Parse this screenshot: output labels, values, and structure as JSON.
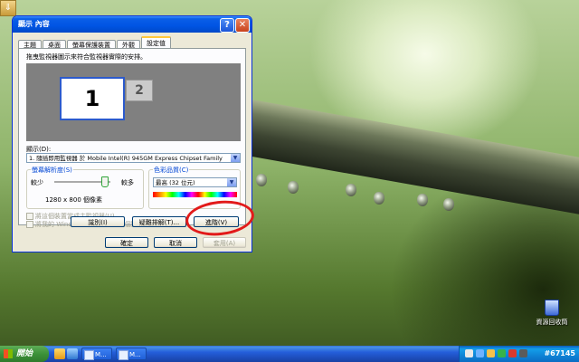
{
  "dialog": {
    "title": "顯示 內容",
    "help_label": "?",
    "close_label": "✕",
    "tabs": [
      {
        "label": "主題",
        "active": false
      },
      {
        "label": "桌面",
        "active": false
      },
      {
        "label": "螢幕保護裝置",
        "active": false
      },
      {
        "label": "外觀",
        "active": false
      },
      {
        "label": "設定值",
        "active": true
      }
    ],
    "instruction": "拖曳監視器圖示來符合監視器實際的安排。",
    "monitors": [
      "1",
      "2"
    ],
    "display_label": "顯示(D):",
    "display_value": "1. 隨插即用監視器 於 Mobile Intel(R) 945GM Express Chipset Family",
    "resolution": {
      "legend": "螢幕解析度(S)",
      "less": "較少",
      "more": "較多",
      "value_text": "1280 x 800 個像素",
      "slider_level": 0.9
    },
    "color_quality": {
      "legend": "色彩品質(C)",
      "value": "最高 (32 位元)"
    },
    "checkboxes": [
      {
        "label": "將這個裝置當成主監視器(U)",
        "checked": false,
        "enabled": false
      },
      {
        "label": "將我的 Windows 桌面延伸到這個監視器(E)",
        "checked": false,
        "enabled": false
      }
    ],
    "buttons": {
      "identify": "識別(I)",
      "troubleshoot": "疑難排解(T)...",
      "advanced": "進階(V)",
      "ok": "確定",
      "cancel": "取消",
      "apply": "套用(A)"
    }
  },
  "desktop": {
    "recycle_bin_label": "資源回收筒"
  },
  "taskbar": {
    "start_label": "開始",
    "tasks": [
      "M...",
      "M..."
    ],
    "clock": "#67145"
  },
  "colors": {
    "titlebar": "#0054e3",
    "dialog_bg": "#ece9d8",
    "annotation": "#e21a1a",
    "taskbar": "#245edb",
    "start_button": "#3c9239"
  }
}
